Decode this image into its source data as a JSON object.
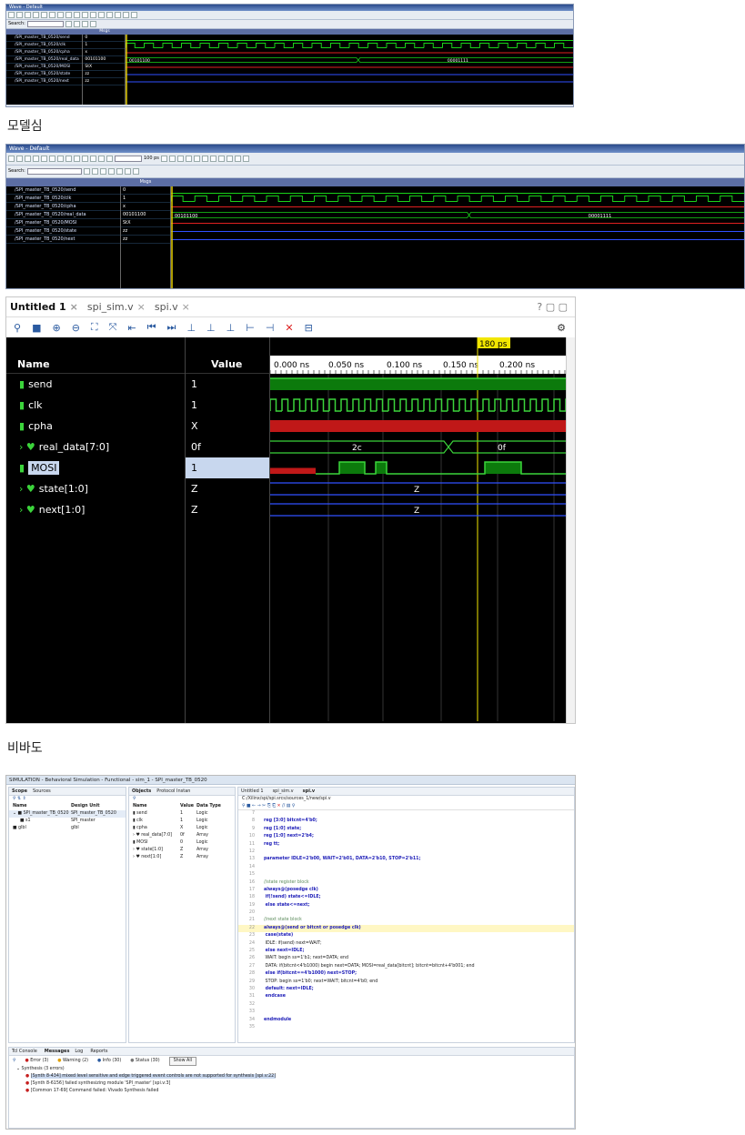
{
  "modelsim_small": {
    "title": "Wave - Default",
    "search_label": "Search:",
    "msgs_label": "Msgs",
    "signals": [
      {
        "name": "/SPI_master_TB_0520/send",
        "value": "0"
      },
      {
        "name": "/SPI_master_TB_0520/clk",
        "value": "1"
      },
      {
        "name": "/SPI_master_TB_0520/cpha",
        "value": "x"
      },
      {
        "name": "/SPI_master_TB_0520/real_data",
        "value": "00101100"
      },
      {
        "name": "/SPI_master_TB_0520/MOSI",
        "value": "StX"
      },
      {
        "name": "/SPI_master_TB_0520/state",
        "value": "zz"
      },
      {
        "name": "/SPI_master_TB_0520/next",
        "value": "zz"
      }
    ],
    "bus_values": [
      "00101100",
      "00001111"
    ]
  },
  "caption1": "모델심",
  "modelsim_large": {
    "title": "Wave - Default",
    "search_label": "Search:",
    "msgs_label": "Msgs",
    "zoom_value": "100 ps",
    "signals": [
      {
        "name": "/SPI_master_TB_0520/send",
        "value": "0"
      },
      {
        "name": "/SPI_master_TB_0520/clk",
        "value": "1"
      },
      {
        "name": "/SPI_master_TB_0520/cpha",
        "value": "x"
      },
      {
        "name": "/SPI_master_TB_0520/real_data",
        "value": "00101100"
      },
      {
        "name": "/SPI_master_TB_0520/MOSI",
        "value": "StX"
      },
      {
        "name": "/SPI_master_TB_0520/state",
        "value": "zz"
      },
      {
        "name": "/SPI_master_TB_0520/next",
        "value": "zz"
      }
    ],
    "bus_values": [
      "00101100",
      "00001111"
    ]
  },
  "vivado_wave": {
    "tabs": [
      "Untitled 1",
      "spi_sim.v",
      "spi.v"
    ],
    "col_name": "Name",
    "col_value": "Value",
    "cursor_time": "180 ps",
    "time_ticks": [
      "0.000 ns",
      "0.050 ns",
      "0.100 ns",
      "0.150 ns",
      "0.200 ns"
    ],
    "signals": [
      {
        "name": "send",
        "value": "1"
      },
      {
        "name": "clk",
        "value": "1"
      },
      {
        "name": "cpha",
        "value": "X"
      },
      {
        "name": "real_data[7:0]",
        "value": "0f"
      },
      {
        "name": "MOSI",
        "value": "1"
      },
      {
        "name": "state[1:0]",
        "value": "Z"
      },
      {
        "name": "next[1:0]",
        "value": "Z"
      }
    ],
    "bus_labels": {
      "real_data_1": "2c",
      "real_data_2": "0f",
      "state": "Z",
      "next": "Z"
    }
  },
  "caption2": "비바도",
  "vivado_sim": {
    "title": "SIMULATION - Behavioral Simulation - Functional - sim_1 - SPI_master_TB_0520",
    "scope": {
      "tabs": [
        "Scope",
        "Sources"
      ],
      "headers": [
        "Name",
        "Design Unit"
      ],
      "rows": [
        {
          "name": "SPI_master_TB_0520",
          "unit": "SPI_master_TB_0520"
        },
        {
          "name": "s1",
          "unit": "SPI_master"
        },
        {
          "name": "glbl",
          "unit": "glbl"
        }
      ]
    },
    "objects": {
      "tabs": [
        "Objects",
        "Protocol Instan"
      ],
      "headers": [
        "Name",
        "Value",
        "Data Type"
      ],
      "rows": [
        {
          "name": "send",
          "value": "1",
          "type": "Logic"
        },
        {
          "name": "clk",
          "value": "1",
          "type": "Logic"
        },
        {
          "name": "cpha",
          "value": "X",
          "type": "Logic"
        },
        {
          "name": "real_data[7:0]",
          "value": "0f",
          "type": "Array"
        },
        {
          "name": "MOSI",
          "value": "0",
          "type": "Logic"
        },
        {
          "name": "state[1:0]",
          "value": "Z",
          "type": "Array"
        },
        {
          "name": "next[1:0]",
          "value": "Z",
          "type": "Array"
        }
      ]
    },
    "editor": {
      "tabs": [
        "Untitled 1",
        "spi_sim.v",
        "spi.v"
      ],
      "path": "C:/Xilinx/spi/spi.srcs/sources_1/new/spi.v",
      "lines": [
        {
          "n": "7",
          "t": ""
        },
        {
          "n": "8",
          "t": "reg [3:0] bitcnt=4'b0;"
        },
        {
          "n": "9",
          "t": "reg [1:0] state;"
        },
        {
          "n": "10",
          "t": "reg [1:0] next=2'b4;"
        },
        {
          "n": "11",
          "t": "reg tt;"
        },
        {
          "n": "12",
          "t": ""
        },
        {
          "n": "13",
          "t": "parameter IDLE=2'b00, WAIT=2'b01, DATA=2'b10, STOP=2'b11;"
        },
        {
          "n": "14",
          "t": ""
        },
        {
          "n": "15",
          "t": ""
        },
        {
          "n": "16",
          "t": "//state register block"
        },
        {
          "n": "17",
          "t": "always@(posedge clk)"
        },
        {
          "n": "18",
          "t": "    if(!send) state<=IDLE;"
        },
        {
          "n": "19",
          "t": "    else state<=next;"
        },
        {
          "n": "20",
          "t": ""
        },
        {
          "n": "21",
          "t": "//next state block"
        },
        {
          "n": "22",
          "t": "always@(send or bitcnt or posedge clk)"
        },
        {
          "n": "23",
          "t": "    case(state)"
        },
        {
          "n": "24",
          "t": "        IDLE: if(send) next=WAIT;"
        },
        {
          "n": "25",
          "t": "              else next=IDLE;"
        },
        {
          "n": "26",
          "t": "        WAIT: begin ss=1'b1; next=DATA; end"
        },
        {
          "n": "27",
          "t": "        DATA: if(bitcnt<4'b1000) begin next=DATA; MOSI=real_data[bitcnt]; bitcnt=bitcnt+4'b001; end"
        },
        {
          "n": "28",
          "t": "              else if(bitcnt==4'b1000) next=STOP;"
        },
        {
          "n": "29",
          "t": "        STOP: begin ss=1'b0; next=WAIT; bitcnt=4'b0; end"
        },
        {
          "n": "30",
          "t": "        default: next=IDLE;"
        },
        {
          "n": "31",
          "t": "    endcase"
        },
        {
          "n": "32",
          "t": ""
        },
        {
          "n": "33",
          "t": ""
        },
        {
          "n": "34",
          "t": "endmodule"
        },
        {
          "n": "35",
          "t": ""
        }
      ]
    },
    "console": {
      "tabs": [
        "Tcl Console",
        "Messages",
        "Log",
        "Reports"
      ],
      "filters": [
        "Error (3)",
        "Warning (2)",
        "Info (30)",
        "Status (30)"
      ],
      "show_all": "Show All",
      "group": "Synthesis (3 errors)",
      "messages": [
        "[Synth 8-434] mixed level sensitive and edge triggered event controls are not supported for synthesis [spi.v:22]",
        "[Synth 8-6156] failed synthesizing module 'SPI_master' [spi.v:3]",
        "[Common 17-69] Command failed: Vivado Synthesis failed"
      ]
    }
  }
}
